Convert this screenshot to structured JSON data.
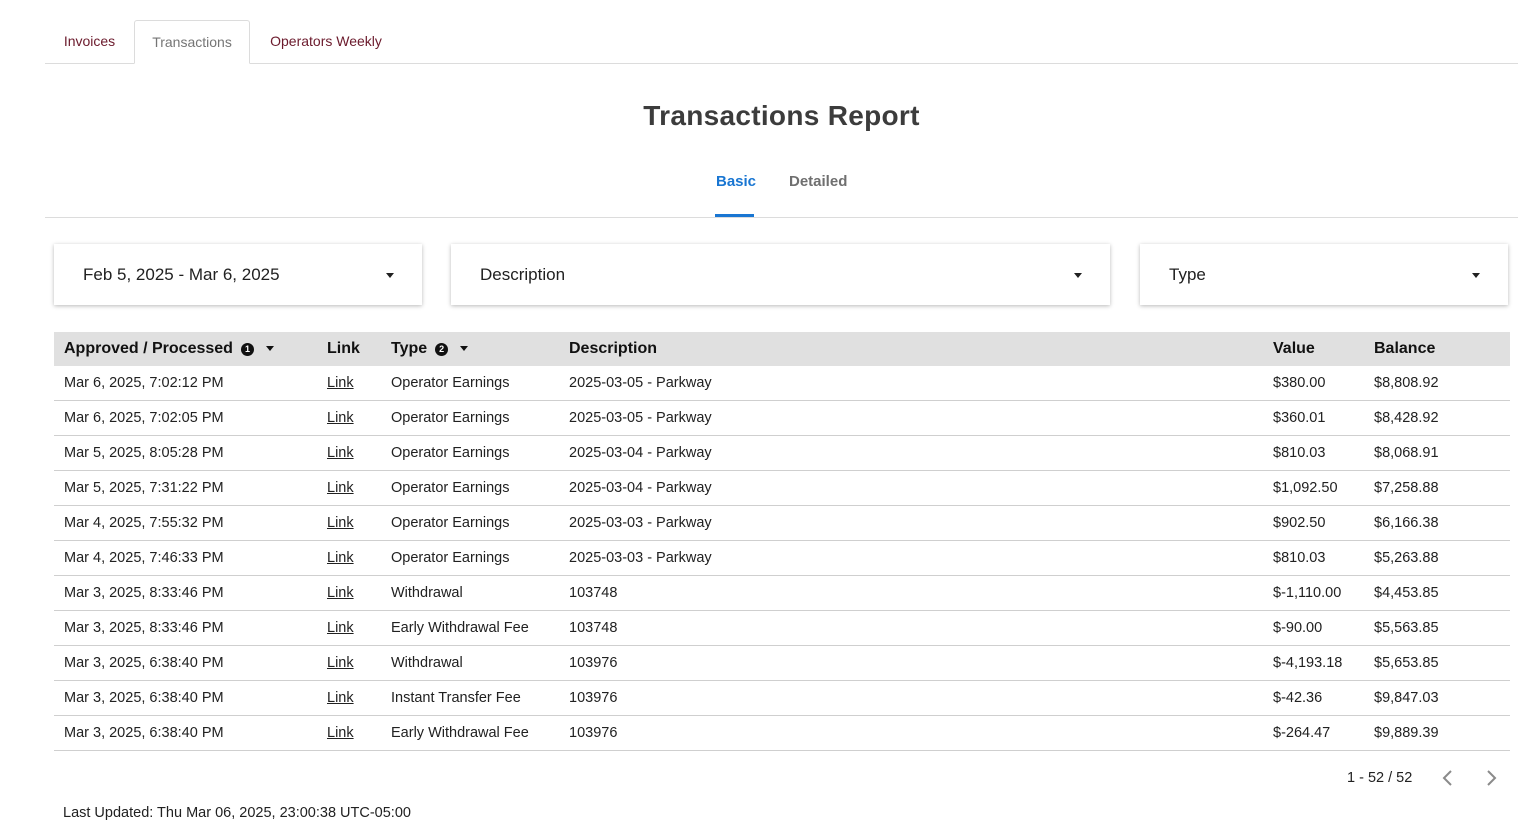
{
  "top_tabs": [
    {
      "label": "Invoices",
      "active": false
    },
    {
      "label": "Transactions",
      "active": true
    },
    {
      "label": "Operators Weekly",
      "active": false
    }
  ],
  "page_title": "Transactions Report",
  "sub_tabs": [
    {
      "label": "Basic",
      "active": true
    },
    {
      "label": "Detailed",
      "active": false
    }
  ],
  "filters": {
    "date_range": "Feb 5, 2025 - Mar 6, 2025",
    "description": "Description",
    "type": "Type"
  },
  "table": {
    "headers": {
      "approved": "Approved / Processed",
      "approved_badge": "1",
      "link": "Link",
      "type": "Type",
      "type_badge": "2",
      "description": "Description",
      "value": "Value",
      "balance": "Balance"
    },
    "rows": [
      {
        "date": "Mar 6, 2025, 7:02:12 PM",
        "link": "Link",
        "type": "Operator Earnings",
        "description": "2025-03-05 - Parkway",
        "value": "$380.00",
        "balance": "$8,808.92"
      },
      {
        "date": "Mar 6, 2025, 7:02:05 PM",
        "link": "Link",
        "type": "Operator Earnings",
        "description": "2025-03-05 - Parkway",
        "value": "$360.01",
        "balance": "$8,428.92"
      },
      {
        "date": "Mar 5, 2025, 8:05:28 PM",
        "link": "Link",
        "type": "Operator Earnings",
        "description": "2025-03-04 - Parkway",
        "value": "$810.03",
        "balance": "$8,068.91"
      },
      {
        "date": "Mar 5, 2025, 7:31:22 PM",
        "link": "Link",
        "type": "Operator Earnings",
        "description": "2025-03-04 - Parkway",
        "value": "$1,092.50",
        "balance": "$7,258.88"
      },
      {
        "date": "Mar 4, 2025, 7:55:32 PM",
        "link": "Link",
        "type": "Operator Earnings",
        "description": "2025-03-03 - Parkway",
        "value": "$902.50",
        "balance": "$6,166.38"
      },
      {
        "date": "Mar 4, 2025, 7:46:33 PM",
        "link": "Link",
        "type": "Operator Earnings",
        "description": "2025-03-03 - Parkway",
        "value": "$810.03",
        "balance": "$5,263.88"
      },
      {
        "date": "Mar 3, 2025, 8:33:46 PM",
        "link": "Link",
        "type": "Withdrawal",
        "description": "103748",
        "value": "$-1,110.00",
        "balance": "$4,453.85"
      },
      {
        "date": "Mar 3, 2025, 8:33:46 PM",
        "link": "Link",
        "type": "Early Withdrawal Fee",
        "description": "103748",
        "value": "$-90.00",
        "balance": "$5,563.85"
      },
      {
        "date": "Mar 3, 2025, 6:38:40 PM",
        "link": "Link",
        "type": "Withdrawal",
        "description": "103976",
        "value": "$-4,193.18",
        "balance": "$5,653.85"
      },
      {
        "date": "Mar 3, 2025, 6:38:40 PM",
        "link": "Link",
        "type": "Instant Transfer Fee",
        "description": "103976",
        "value": "$-42.36",
        "balance": "$9,847.03"
      },
      {
        "date": "Mar 3, 2025, 6:38:40 PM",
        "link": "Link",
        "type": "Early Withdrawal Fee",
        "description": "103976",
        "value": "$-264.47",
        "balance": "$9,889.39"
      }
    ]
  },
  "pagination": {
    "range": "1 - 52 / 52",
    "prev_icon": "chevron-left-icon",
    "next_icon": "chevron-right-icon"
  },
  "last_updated": "Last Updated: Thu Mar 06, 2025, 23:00:38 UTC-05:00",
  "colors": {
    "accent": "#1976d2",
    "tab_text": "#6b1a2c",
    "header_bg": "#e0e0e0"
  }
}
